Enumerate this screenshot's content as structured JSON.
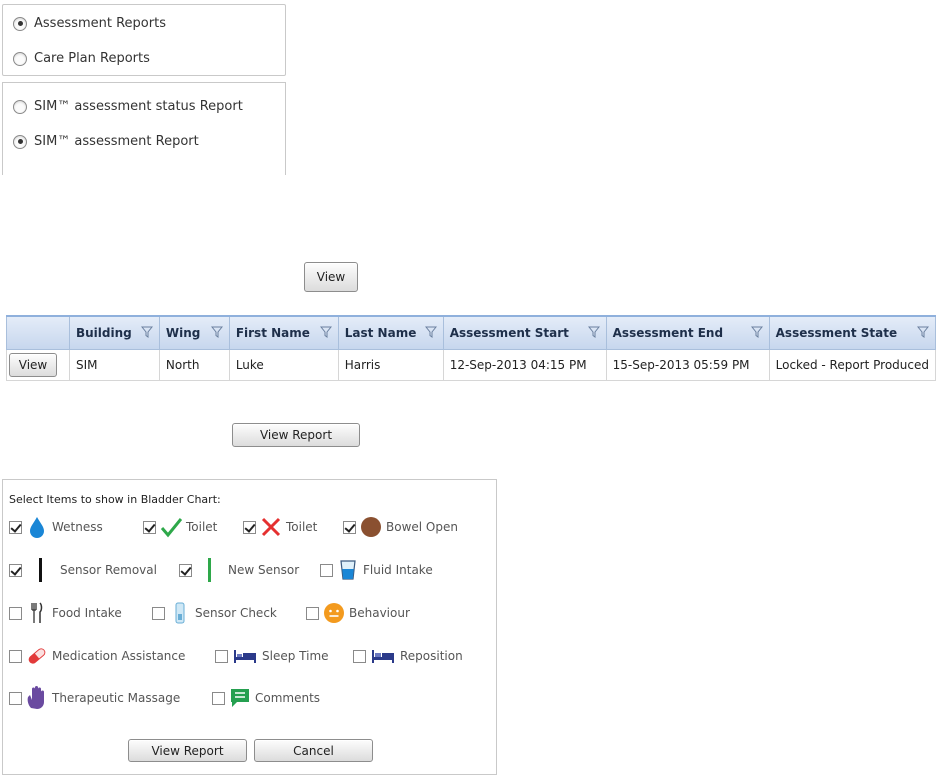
{
  "report_type": {
    "options": [
      {
        "label": "Assessment Reports",
        "selected": true
      },
      {
        "label": "Care Plan Reports",
        "selected": false
      }
    ]
  },
  "sim_report": {
    "options": [
      {
        "label": "SIM™ assessment status Report",
        "selected": false
      },
      {
        "label": "SIM™ assessment Report",
        "selected": true
      }
    ]
  },
  "buttons": {
    "view": "View",
    "view_report": "View Report",
    "panel_view_report": "View Report",
    "cancel": "Cancel"
  },
  "grid": {
    "columns": [
      "Building",
      "Wing",
      "First Name",
      "Last Name",
      "Assessment Start",
      "Assessment End",
      "Assessment State"
    ],
    "rows": [
      {
        "action": "View",
        "building": "SIM",
        "wing": "North",
        "first_name": "Luke",
        "last_name": "Harris",
        "start": "12-Sep-2013 04:15 PM",
        "end": "15-Sep-2013 05:59 PM",
        "state": "Locked - Report Produced"
      }
    ]
  },
  "bladder_chart": {
    "title": "Select Items to show in Bladder Chart:",
    "items": [
      {
        "label": "Wetness",
        "checked": true,
        "icon": "water-drop-icon"
      },
      {
        "label": "Toilet",
        "checked": true,
        "icon": "green-check-icon"
      },
      {
        "label": "Toilet",
        "checked": true,
        "icon": "red-cross-icon"
      },
      {
        "label": "Bowel Open",
        "checked": true,
        "icon": "brown-circle-icon"
      },
      {
        "label": "Sensor Removal",
        "checked": true,
        "icon": "black-bar-icon"
      },
      {
        "label": "New Sensor",
        "checked": true,
        "icon": "green-bar-icon"
      },
      {
        "label": "Fluid Intake",
        "checked": false,
        "icon": "cup-icon"
      },
      {
        "label": "Food Intake",
        "checked": false,
        "icon": "cutlery-icon"
      },
      {
        "label": "Sensor Check",
        "checked": false,
        "icon": "sensor-icon"
      },
      {
        "label": "Behaviour",
        "checked": false,
        "icon": "smiley-icon"
      },
      {
        "label": "Medication Assistance",
        "checked": false,
        "icon": "pill-icon"
      },
      {
        "label": "Sleep Time",
        "checked": false,
        "icon": "bed-icon"
      },
      {
        "label": "Reposition",
        "checked": false,
        "icon": "bed-reposition-icon"
      },
      {
        "label": "Therapeutic Massage",
        "checked": false,
        "icon": "hand-icon"
      },
      {
        "label": "Comments",
        "checked": false,
        "icon": "comment-icon"
      }
    ]
  },
  "colors": {
    "header_bg": "#c7d7ee",
    "header_border": "#8fb0dc",
    "drop": "#1a86d6",
    "check_green": "#2ea84a",
    "cross_red": "#e53030",
    "bowel_brown": "#8a5030",
    "smiley_orange": "#f39a1e",
    "pill_red": "#e23a3a",
    "bed_navy": "#2b3a8a",
    "hand_purple": "#6a4aa0",
    "comment_green": "#25a050"
  }
}
